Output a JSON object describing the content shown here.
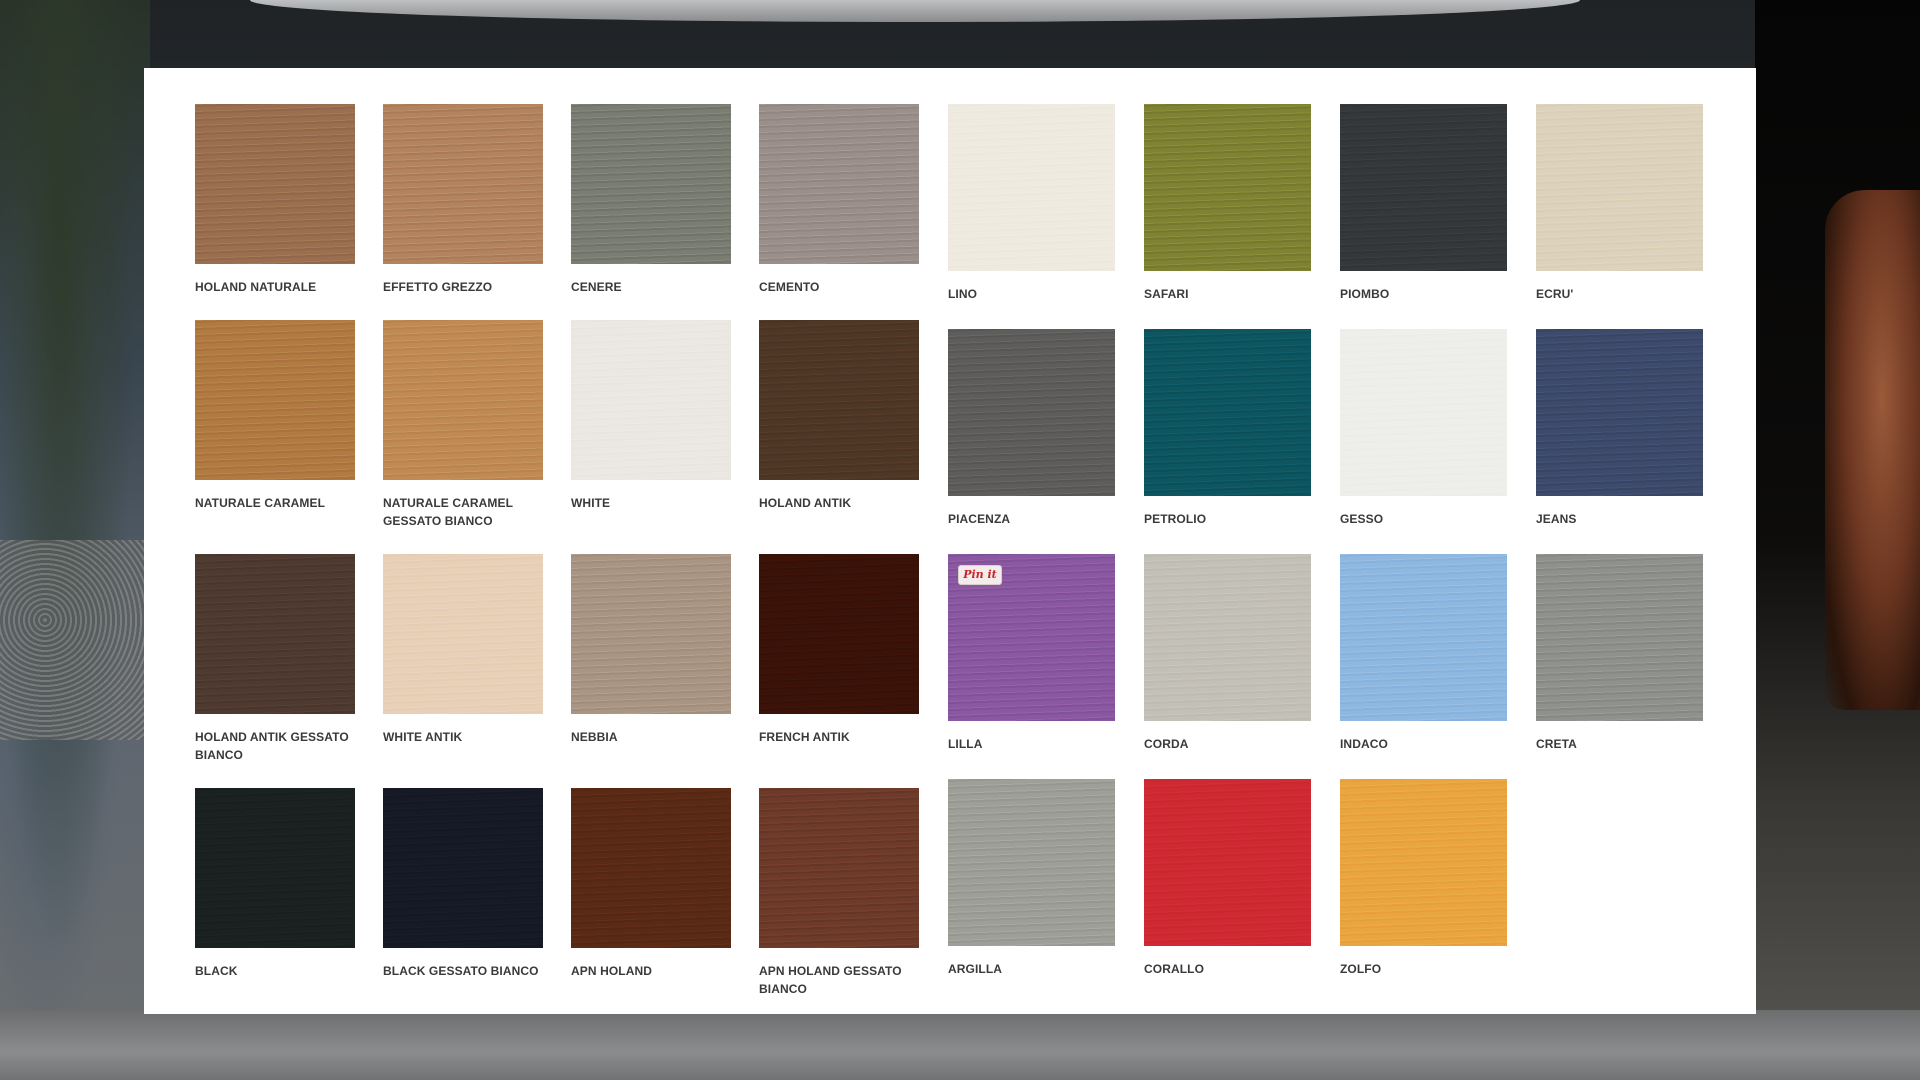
{
  "wood_finishes": [
    {
      "label": "HOLAND NATURALE",
      "color": "#9a6f4f"
    },
    {
      "label": "EFFETTO GREZZO",
      "color": "#b2835e"
    },
    {
      "label": "CENERE",
      "color": "#7a7d72"
    },
    {
      "label": "CEMENTO",
      "color": "#9a8f8a"
    },
    {
      "label": "NATURALE CARAMEL",
      "color": "#b07a42"
    },
    {
      "label": "NATURALE CARAMEL GESSATO BIANCO",
      "color": "#c08a55"
    },
    {
      "label": "WHITE",
      "color": "#ebe7e2"
    },
    {
      "label": "HOLAND ANTIK",
      "color": "#4f3726"
    },
    {
      "label": "HOLAND ANTIK GESSATO BIANCO",
      "color": "#4e3a30"
    },
    {
      "label": "WHITE ANTIK",
      "color": "#e8d0b8"
    },
    {
      "label": "NEBBIA",
      "color": "#a99584"
    },
    {
      "label": "FRENCH ANTIK",
      "color": "#3a1208"
    },
    {
      "label": "BLACK",
      "color": "#1b2020"
    },
    {
      "label": "BLACK GESSATO BIANCO",
      "color": "#161a26"
    },
    {
      "label": "APN HOLAND",
      "color": "#5a2a15"
    },
    {
      "label": "APN HOLAND GESSATO BIANCO",
      "color": "#6e3a2a"
    }
  ],
  "lacquer_finishes": [
    {
      "label": "LINO",
      "color": "#efeae0"
    },
    {
      "label": "SAFARI",
      "color": "#7f8232"
    },
    {
      "label": "PIOMBO",
      "color": "#35383a"
    },
    {
      "label": "ECRU'",
      "color": "#ddd2bc"
    },
    {
      "label": "PIACENZA",
      "color": "#5f5d5b"
    },
    {
      "label": "PETROLIO",
      "color": "#0d5660"
    },
    {
      "label": "GESSO",
      "color": "#eeeeea"
    },
    {
      "label": "JEANS",
      "color": "#3d4a6b"
    },
    {
      "label": "LILLA",
      "color": "#8a58a0",
      "pin_label": "Pin it"
    },
    {
      "label": "CORDA",
      "color": "#c3c0b7"
    },
    {
      "label": "INDACO",
      "color": "#8fb8e0"
    },
    {
      "label": "CRETA",
      "color": "#8f918d"
    },
    {
      "label": "ARGILLA",
      "color": "#9e9f98"
    },
    {
      "label": "CORALLO",
      "color": "#cf2a33"
    },
    {
      "label": "ZOLFO",
      "color": "#e9a540"
    }
  ]
}
